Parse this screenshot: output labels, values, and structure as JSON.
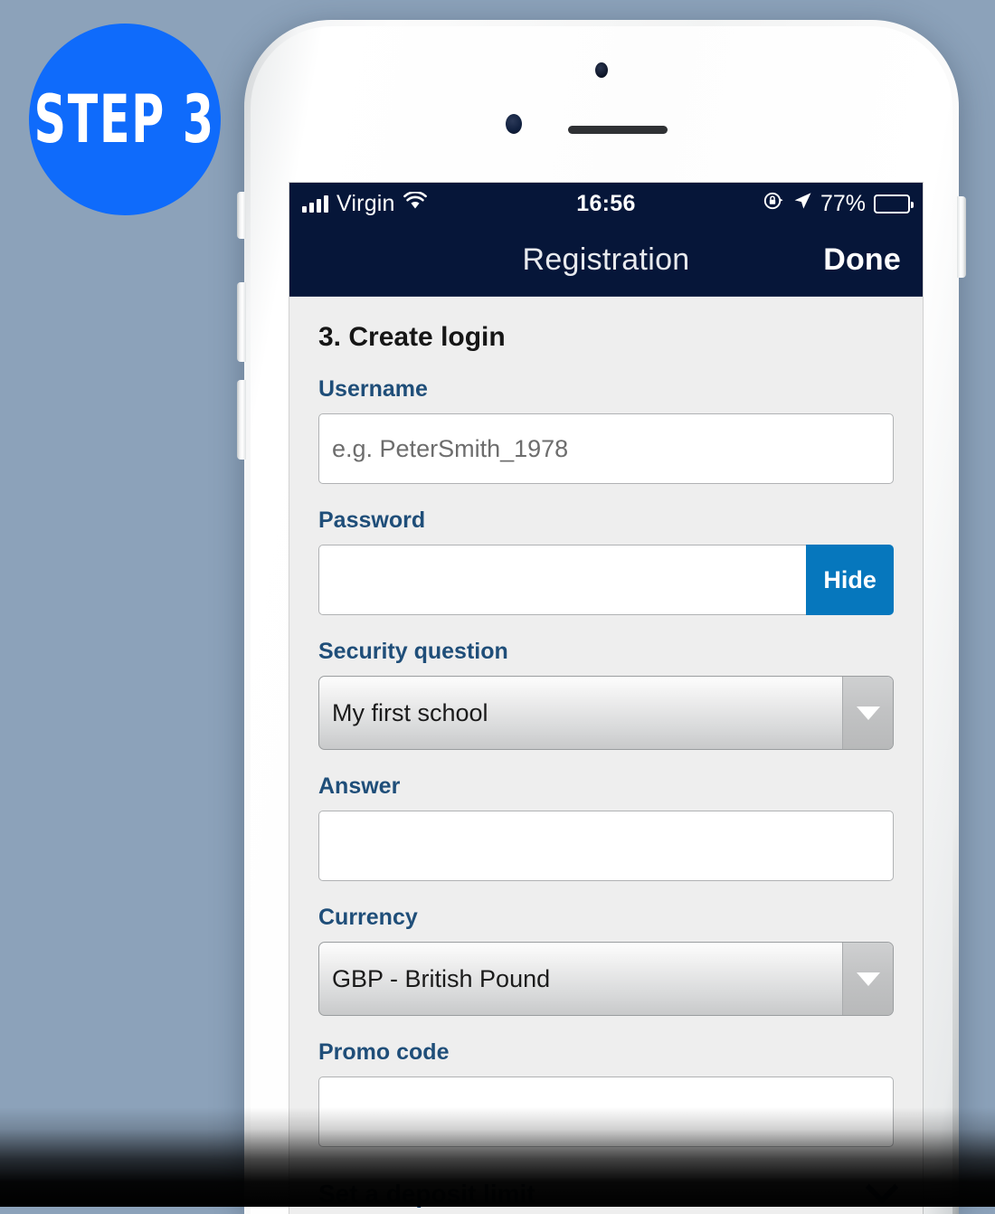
{
  "badge": {
    "label": "STEP 3",
    "color": "#0f6bfb"
  },
  "theme": {
    "background": "#8ca2ba",
    "navbar": "#061639",
    "label_blue": "#1f4e79",
    "action_blue": "#0677bd",
    "screen_background": "#eeeeee"
  },
  "status_bar": {
    "carrier": "Virgin",
    "signal_icon": "signal-bars-icon",
    "wifi_icon": "wifi-icon",
    "time": "16:56",
    "rotation_lock_icon": "rotation-lock-icon",
    "location_icon": "location-arrow-icon",
    "battery_percent": "77%",
    "battery_icon": "battery-icon",
    "battery_level": 77
  },
  "nav_bar": {
    "title": "Registration",
    "done_label": "Done"
  },
  "form": {
    "section_title": "3. Create login",
    "fields": [
      {
        "name": "username",
        "label": "Username",
        "type": "text",
        "value": "",
        "placeholder": "e.g. PeterSmith_1978"
      },
      {
        "name": "password",
        "label": "Password",
        "type": "password",
        "value": "",
        "placeholder": "",
        "action_label": "Hide"
      },
      {
        "name": "security_question",
        "label": "Security question",
        "type": "select",
        "value": "My first school",
        "arrow_icon": "chevron-down-icon"
      },
      {
        "name": "answer",
        "label": "Answer",
        "type": "text",
        "value": "",
        "placeholder": ""
      },
      {
        "name": "currency",
        "label": "Currency",
        "type": "select",
        "value": "GBP - British Pound",
        "arrow_icon": "chevron-down-icon"
      },
      {
        "name": "promo_code",
        "label": "Promo code",
        "type": "text",
        "value": "",
        "placeholder": ""
      }
    ],
    "collapsed_section": {
      "label": "Set a deposit limit",
      "chevron_icon": "chevron-down-icon"
    }
  },
  "device": {
    "camera_icon": "camera-icon",
    "sensor_icon": "proximity-sensor-icon",
    "speaker_icon": "earpiece-speaker-icon",
    "mute_switch": "mute-switch-button",
    "volume_up": "volume-up-button",
    "volume_down": "volume-down-button",
    "power": "power-button"
  }
}
